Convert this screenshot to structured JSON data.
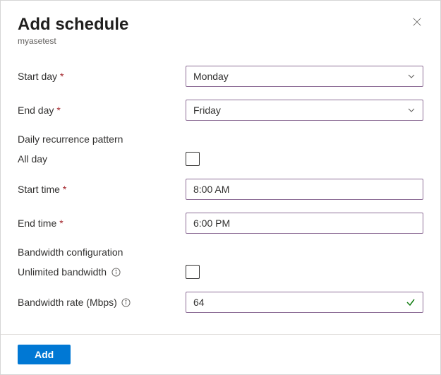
{
  "title": "Add schedule",
  "subtitle": "myasetest",
  "fields": {
    "start_day": {
      "label": "Start day",
      "value": "Monday",
      "required": true
    },
    "end_day": {
      "label": "End day",
      "value": "Friday",
      "required": true
    },
    "recurrence_heading": "Daily recurrence pattern",
    "all_day": {
      "label": "All day",
      "checked": false
    },
    "start_time": {
      "label": "Start time",
      "value": "8:00 AM",
      "required": true
    },
    "end_time": {
      "label": "End time",
      "value": "6:00 PM",
      "required": true
    },
    "bandwidth_heading": "Bandwidth configuration",
    "unlimited": {
      "label": "Unlimited bandwidth",
      "checked": false
    },
    "rate": {
      "label": "Bandwidth rate (Mbps)",
      "value": "64",
      "valid": true
    }
  },
  "buttons": {
    "add": "Add"
  }
}
